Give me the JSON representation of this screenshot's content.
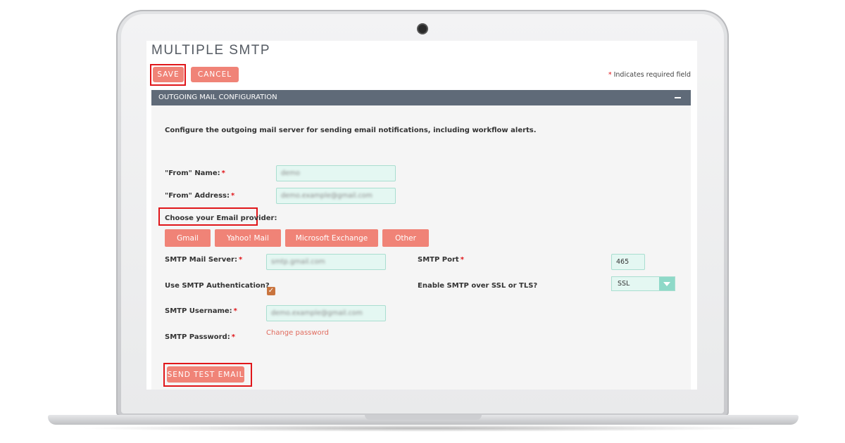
{
  "page": {
    "title": "MULTIPLE SMTP",
    "required_note": "Indicates required field",
    "required_marker": "*"
  },
  "toolbar": {
    "save_label": "SAVE",
    "cancel_label": "CANCEL"
  },
  "panel": {
    "header": "OUTGOING MAIL CONFIGURATION",
    "description": "Configure the outgoing mail server for sending email notifications, including workflow alerts."
  },
  "form": {
    "from_name_label": "\"From\" Name:",
    "from_name_value": "demo",
    "from_address_label": "\"From\" Address:",
    "from_address_value": "demo.example@gmail.com",
    "provider_label": "Choose your Email provider:",
    "providers": [
      "Gmail",
      "Yahoo! Mail",
      "Microsoft Exchange",
      "Other"
    ],
    "smtp_server_label": "SMTP Mail Server:",
    "smtp_server_value": "smtp.gmail.com",
    "smtp_port_label": "SMTP Port",
    "smtp_port_value": "465",
    "smtp_auth_label": "Use SMTP Authentication?",
    "smtp_auth_checked": true,
    "ssl_label": "Enable SMTP over SSL or TLS?",
    "ssl_value": "SSL",
    "username_label": "SMTP Username:",
    "username_value": "demo.example@gmail.com",
    "password_label": "SMTP Password:",
    "change_password_link": "Change password",
    "send_test_label": "SEND TEST EMAIL"
  },
  "colors": {
    "button": "#f08377",
    "header_bar": "#5f6a78",
    "input_bg": "#e4f7f2",
    "highlight": "#e0161a"
  }
}
